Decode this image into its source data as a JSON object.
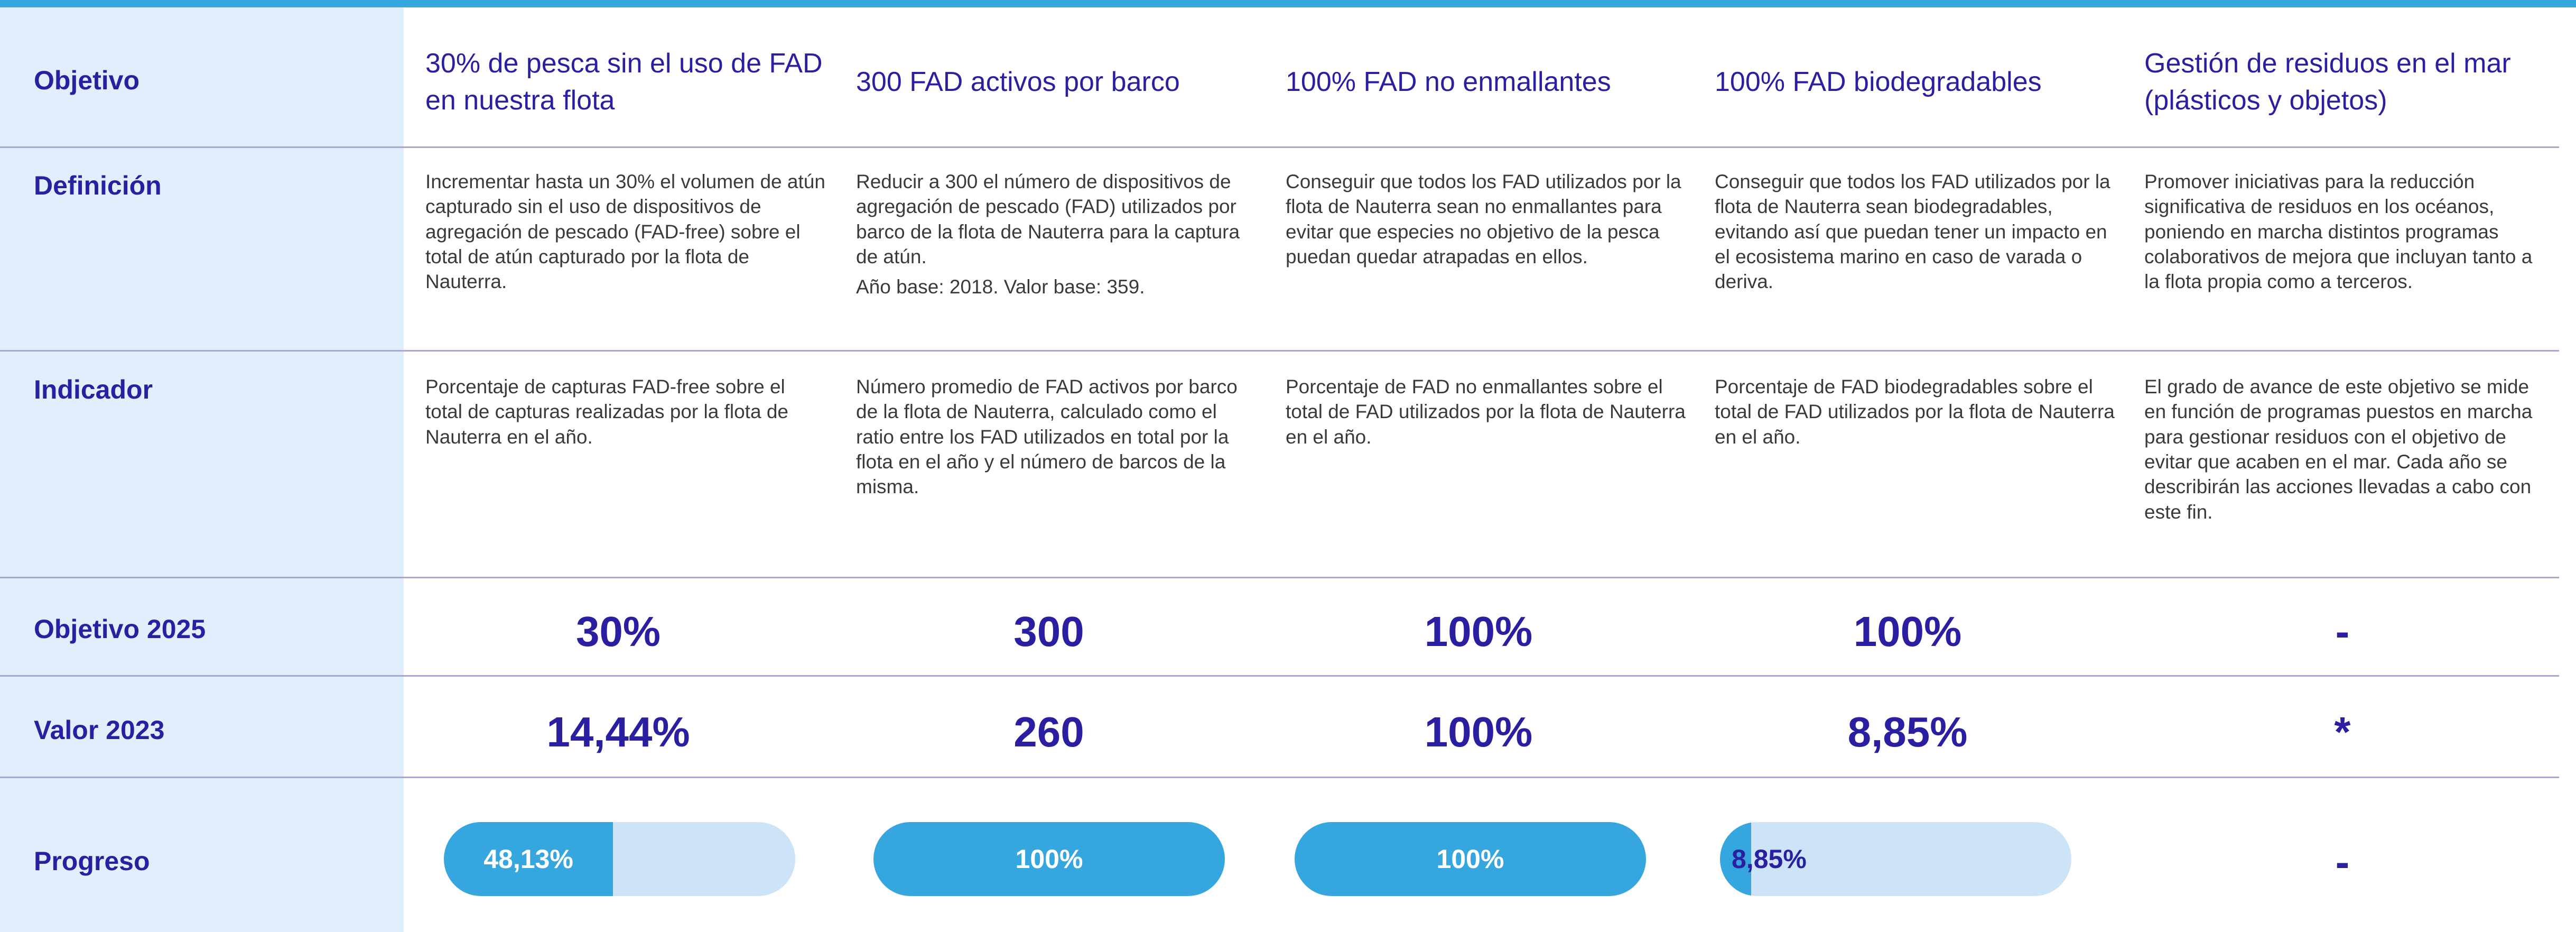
{
  "row_labels": {
    "objetivo": "Objetivo",
    "definicion": "Definición",
    "indicador": "Indicador",
    "objetivo_2025": "Objetivo 2025",
    "valor_2023": "Valor 2023",
    "progreso": "Progreso"
  },
  "columns": [
    {
      "objetivo": "30% de pesca sin el uso de FAD en nuestra flota",
      "definicion": [
        "Incrementar hasta un 30% el volumen de atún capturado sin el uso de dispositivos de agregación de pescado (FAD-free) sobre el total de atún capturado por la flota de Nauterra."
      ],
      "indicador": "Porcentaje de capturas FAD-free sobre el total de capturas realizadas por la flota de Nauterra en el año.",
      "objetivo_2025": "30%",
      "valor_2023": "14,44%",
      "progreso": {
        "label": "48,13%",
        "fraction": 0.4813
      }
    },
    {
      "objetivo": "300 FAD activos por barco",
      "definicion": [
        "Reducir a 300 el número de dispositivos de agregación de pescado (FAD) utilizados por barco de la flota de Nauterra para la captura de atún.",
        "Año base: 2018. Valor base: 359."
      ],
      "indicador": "Número promedio de FAD activos por barco de la flota de Nauterra, calculado como el ratio entre los FAD utilizados en total por la flota en el año y el número de barcos de la misma.",
      "objetivo_2025": "300",
      "valor_2023": "260",
      "progreso": {
        "label": "100%",
        "fraction": 1.0
      }
    },
    {
      "objetivo": "100% FAD no enmallantes",
      "definicion": [
        "Conseguir que todos los FAD utilizados por la flota de Nauterra sean no enmallantes para evitar que especies no objetivo de la pesca puedan quedar atrapadas en ellos."
      ],
      "indicador": "Porcentaje de FAD no enmallantes sobre el total de FAD utilizados por la flota de Nauterra en el año.",
      "objetivo_2025": "100%",
      "valor_2023": "100%",
      "progreso": {
        "label": "100%",
        "fraction": 1.0
      }
    },
    {
      "objetivo": "100% FAD biodegradables",
      "definicion": [
        "Conseguir que todos los FAD utilizados por la flota de Nauterra sean biodegradables, evitando así que puedan tener un impacto en el ecosistema marino en caso de varada o deriva."
      ],
      "indicador": "Porcentaje de FAD biodegradables sobre el total de FAD utilizados por la flota de Nauterra en el año.",
      "objetivo_2025": "100%",
      "valor_2023": "8,85%",
      "progreso": {
        "label": "8,85%",
        "fraction": 0.0885
      }
    },
    {
      "objetivo": "Gestión de residuos en el mar (plásticos y objetos)",
      "definicion": [
        "Promover iniciativas para la reducción significativa de residuos en los océanos, poniendo en marcha distintos programas colaborativos de mejora que incluyan tanto a la flota propia como a terceros."
      ],
      "indicador": "El grado de avance de este objetivo se mide en función de programas puestos en marcha para gestionar residuos con el objetivo de evitar que acaben en el mar. Cada año se describirán las acciones llevadas a cabo con este fin.",
      "objetivo_2025": "-",
      "valor_2023": "*",
      "progreso": {
        "label": "-",
        "fraction": null
      }
    }
  ],
  "colors": {
    "accent_blue": "#36a6df",
    "bar_track": "#cde3f7",
    "label_navy": "#2a1fa0",
    "left_column_bg": "#e1eefb"
  }
}
